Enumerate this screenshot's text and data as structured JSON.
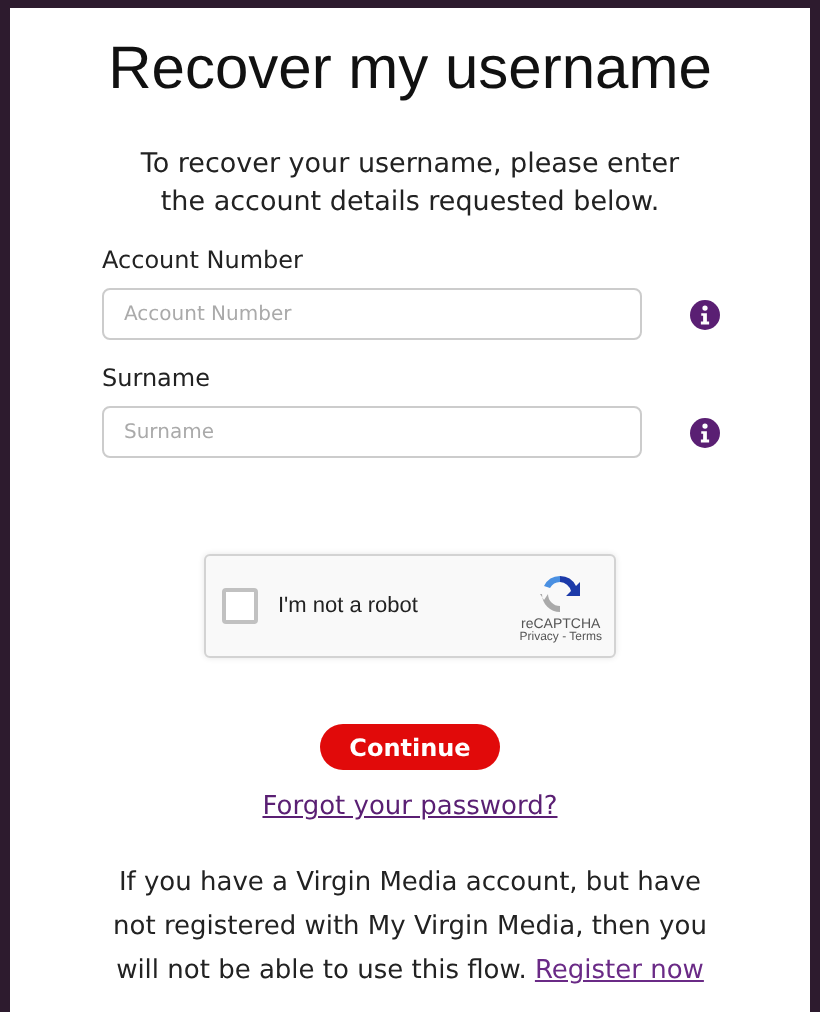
{
  "title": "Recover my username",
  "intro": "To recover your username, please enter the account details requested below.",
  "fields": [
    {
      "label": "Account Number",
      "placeholder": "Account Number"
    },
    {
      "label": "Surname",
      "placeholder": "Surname"
    }
  ],
  "captcha": {
    "label": "I'm not a robot",
    "checked": false,
    "brand": "reCAPTCHA",
    "links": "Privacy - Terms"
  },
  "continue_button": "Continue",
  "forgot_link": "Forgot your password?",
  "notice": {
    "text": "If you have a Virgin Media account, but have not registered with My Virgin Media, then you will not be able to use this flow.",
    "link": "Register now"
  }
}
